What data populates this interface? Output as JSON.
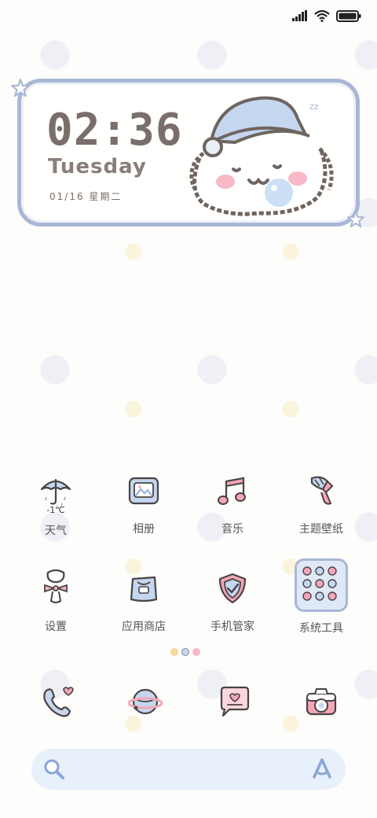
{
  "status_bar": {
    "icons": [
      "signal-icon",
      "wifi-icon",
      "battery-icon"
    ]
  },
  "clock_widget": {
    "time": "02:36",
    "day": "Tuesday",
    "date": "01/16 星期二",
    "accent_color": "#a9b7d6",
    "text_color": "#7a6e6b"
  },
  "apps_row1": [
    {
      "label": "天气",
      "icon": "umbrella-icon",
      "extra": "-1℃"
    },
    {
      "label": "相册",
      "icon": "photo-album-icon"
    },
    {
      "label": "音乐",
      "icon": "music-note-icon"
    },
    {
      "label": "主题壁纸",
      "icon": "paint-brush-icon"
    }
  ],
  "apps_row2": [
    {
      "label": "设置",
      "icon": "settings-bow-icon"
    },
    {
      "label": "应用商店",
      "icon": "shopping-bag-icon"
    },
    {
      "label": "手机管家",
      "icon": "shield-check-icon"
    },
    {
      "label": "系统工具",
      "icon": "tools-folder-icon"
    }
  ],
  "page_indicator": {
    "pages": 3,
    "active": 1
  },
  "dock": [
    {
      "icon": "phone-heart-icon"
    },
    {
      "icon": "browser-planet-icon"
    },
    {
      "icon": "message-heart-icon"
    },
    {
      "icon": "camera-icon"
    }
  ],
  "search_bar": {
    "icons": [
      "search-icon",
      "assistant-icon"
    ],
    "background": "#e7f0fb"
  }
}
